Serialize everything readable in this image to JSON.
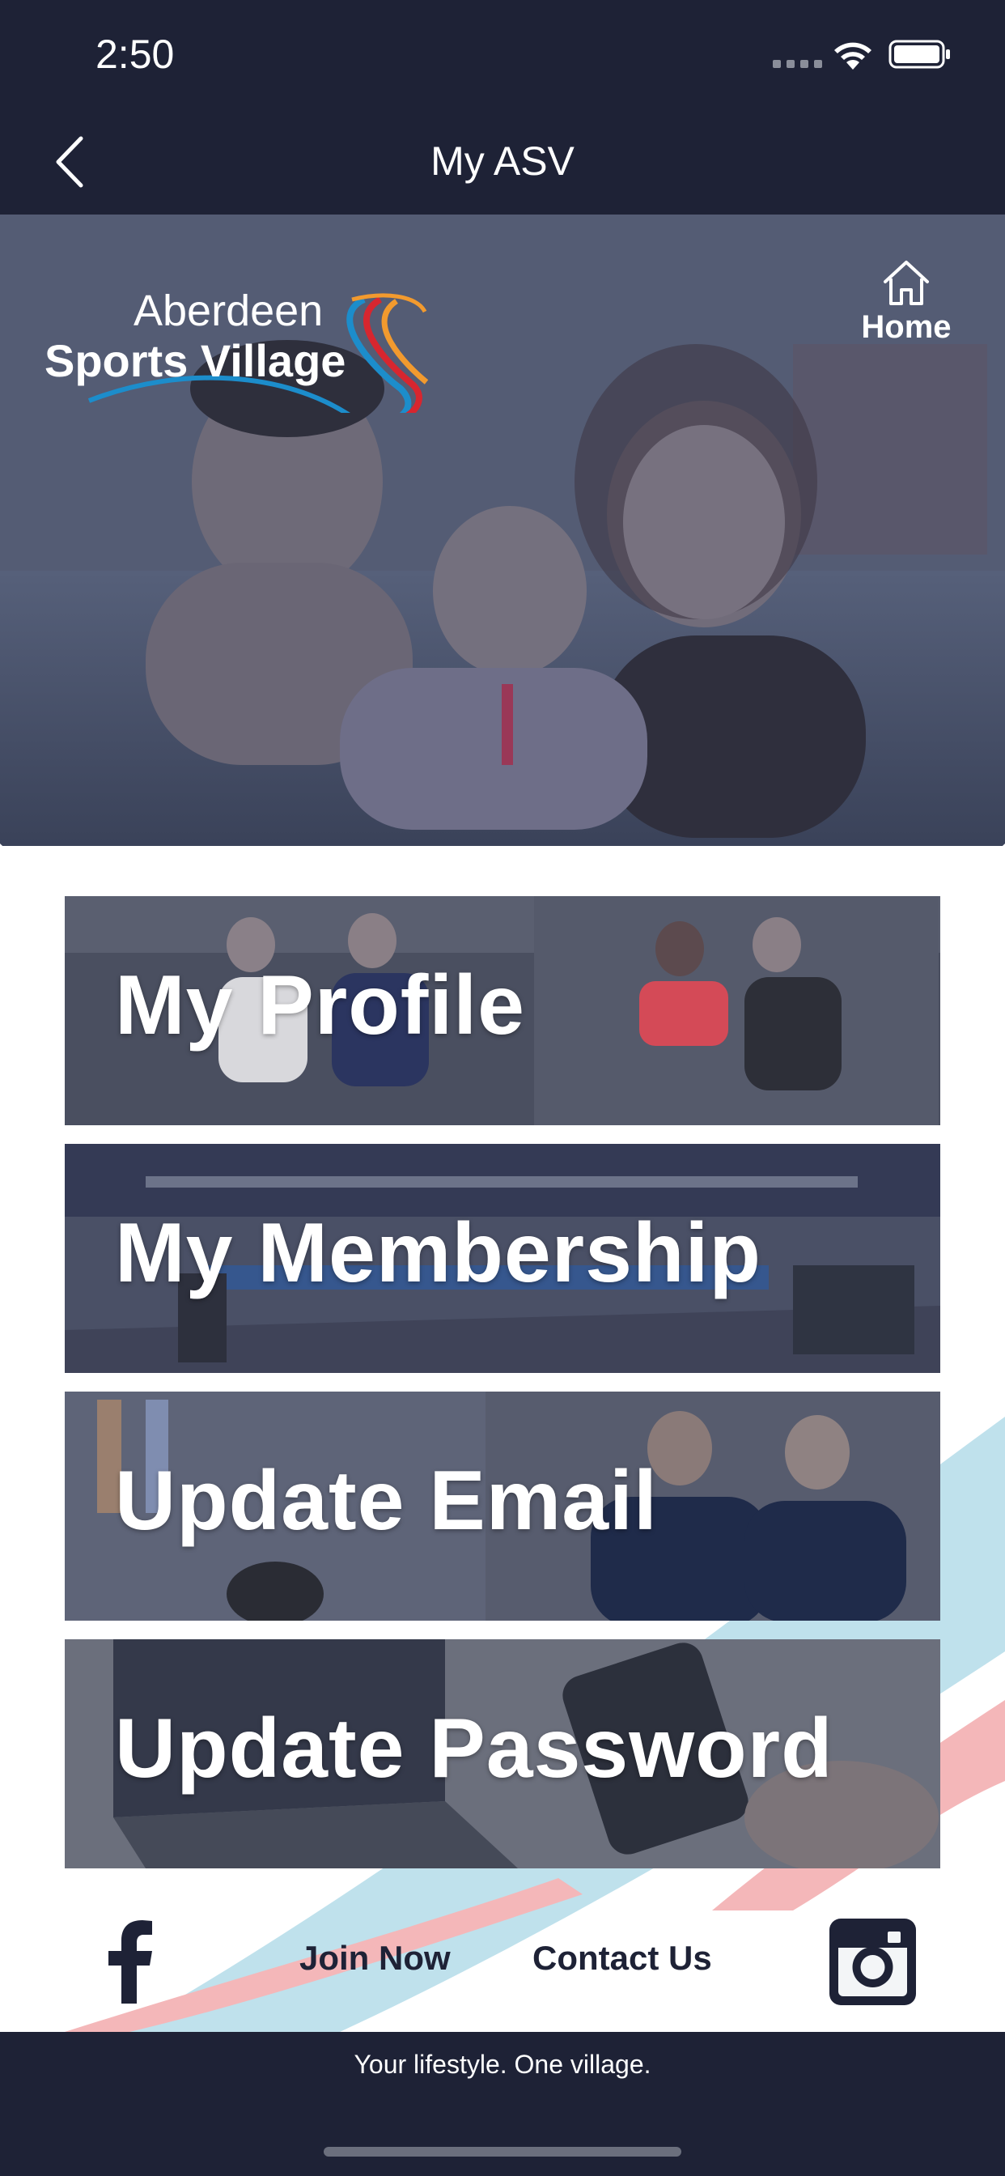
{
  "status_bar": {
    "time": "2:50"
  },
  "nav": {
    "title": "My ASV"
  },
  "hero": {
    "logo_line1": "Aberdeen",
    "logo_line2": "Sports Village",
    "home_label": "Home"
  },
  "menu": [
    {
      "label": "My Profile"
    },
    {
      "label": "My Membership"
    },
    {
      "label": "Update Email"
    },
    {
      "label": "Update Password"
    }
  ],
  "footer": {
    "join_label": "Join Now",
    "contact_label": "Contact Us",
    "tagline": "Your lifestyle. One village."
  },
  "colors": {
    "navy": "#1e2236",
    "stripe_blue": "#bfe1ec",
    "stripe_pink": "#f4b7b9",
    "logo_orange": "#f29a2e",
    "logo_red": "#d7262f",
    "logo_blue": "#1c8dcb"
  },
  "icons": [
    "back-chevron-icon",
    "wifi-icon",
    "battery-icon",
    "home-icon",
    "facebook-icon",
    "instagram-icon"
  ]
}
